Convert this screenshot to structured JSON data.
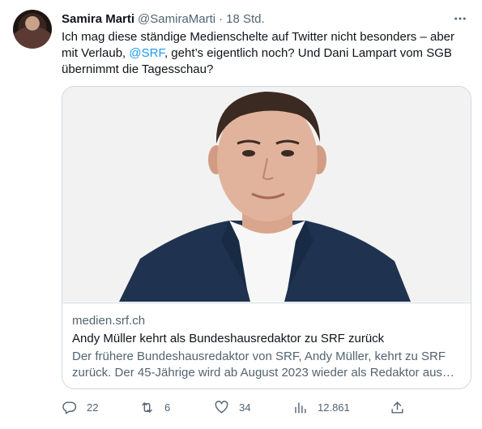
{
  "tweet": {
    "author_name": "Samira Marti",
    "author_handle": "@SamiraMarti",
    "separator": "·",
    "time": "18 Std.",
    "text_part1": "Ich mag diese ständige Medienschelte auf Twitter nicht besonders – aber mit Verlaub, ",
    "mention": "@SRF",
    "text_part2": ", geht’s eigentlich noch? Und Dani Lampart vom SGB übernimmt die Tagesschau?"
  },
  "card": {
    "domain": "medien.srf.ch",
    "title": "Andy Müller kehrt als Bundeshausredaktor zu SRF zurück",
    "description": "Der frühere Bundeshausredaktor von SRF, Andy Müller, kehrt zu SRF zurück. Der 45-Jährige wird ab August 2023 wieder als Redaktor aus…"
  },
  "actions": {
    "replies": "22",
    "retweets": "6",
    "likes": "34",
    "views": "12.861"
  },
  "icons": {
    "more": "more-horizontal-icon",
    "reply": "reply-icon",
    "retweet": "retweet-icon",
    "like": "heart-icon",
    "views": "views-chart-icon",
    "share": "share-icon"
  },
  "colors": {
    "accent": "#1d9bf0",
    "text": "#0f1419",
    "muted": "#536471",
    "border": "#cfd9de"
  }
}
